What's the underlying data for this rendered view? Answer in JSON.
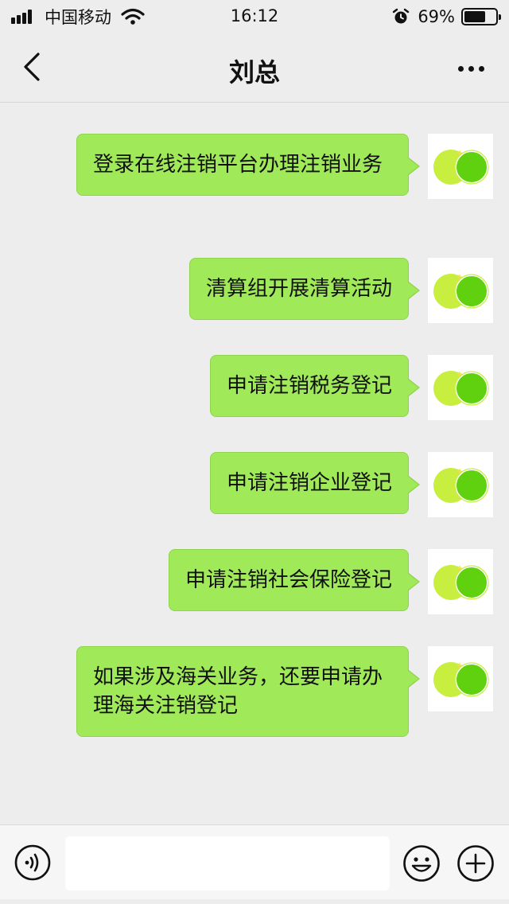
{
  "status_bar": {
    "carrier": "中国移动",
    "time": "16:12",
    "battery_percent_text": "69%",
    "battery_level": 0.69,
    "icons": [
      "signal-icon",
      "wifi-icon",
      "alarm-icon",
      "battery-icon"
    ]
  },
  "nav": {
    "title": "刘总",
    "icons": [
      "back-icon",
      "more-icon"
    ]
  },
  "messages": [
    {
      "text": "登录在线注销平台办理注销业务",
      "side": "right"
    },
    {
      "text": "清算组开展清算活动",
      "side": "right"
    },
    {
      "text": "申请注销税务登记",
      "side": "right"
    },
    {
      "text": "申请注销企业登记",
      "side": "right"
    },
    {
      "text": "申请注销社会保险登记",
      "side": "right"
    },
    {
      "text": "如果涉及海关业务，还要申请办理海关注销登记",
      "side": "right"
    }
  ],
  "input_bar": {
    "value": "",
    "icons": [
      "voice-icon",
      "emoji-icon",
      "plus-icon"
    ]
  },
  "colors": {
    "bubble": "#a0e959",
    "background": "#ededed",
    "avatar_left_circle": "#c8ee3f",
    "avatar_right_circle": "#5fd10f"
  }
}
